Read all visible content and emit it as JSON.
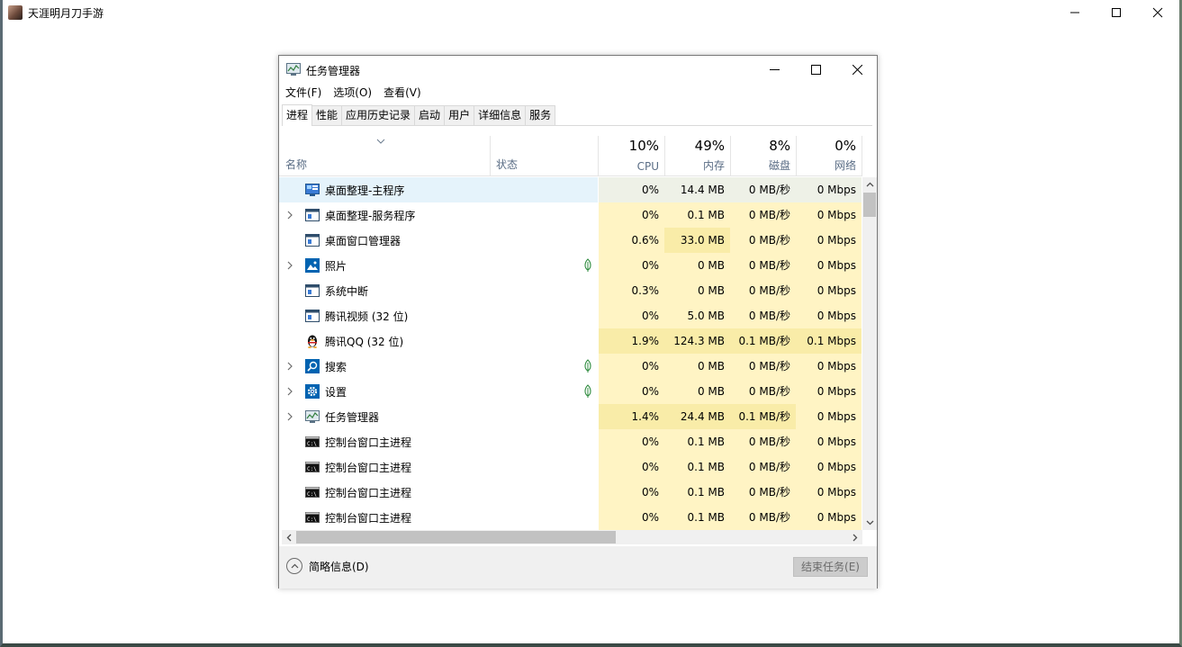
{
  "outer_window": {
    "title": "天涯明月刀手游"
  },
  "task_manager": {
    "title": "任务管理器",
    "menu": [
      "文件(F)",
      "选项(O)",
      "查看(V)"
    ],
    "tabs": [
      "进程",
      "性能",
      "应用历史记录",
      "启动",
      "用户",
      "详细信息",
      "服务"
    ],
    "active_tab": "进程",
    "columns": {
      "name": "名称",
      "status": "状态",
      "cpu": {
        "percent": "10%",
        "label": "CPU"
      },
      "memory": {
        "percent": "49%",
        "label": "内存"
      },
      "disk": {
        "percent": "8%",
        "label": "磁盘"
      },
      "network": {
        "percent": "0%",
        "label": "网络"
      }
    },
    "rows": [
      {
        "name": "桌面整理-主程序",
        "icon": "desktop-app-icon",
        "expandable": false,
        "suspended": false,
        "cpu": "0%",
        "memory": "14.4 MB",
        "disk": "0 MB/秒",
        "network": "0 Mbps",
        "selected": true
      },
      {
        "name": "桌面整理-服务程序",
        "icon": "window-app-icon",
        "expandable": true,
        "suspended": false,
        "cpu": "0%",
        "memory": "0.1 MB",
        "disk": "0 MB/秒",
        "network": "0 Mbps"
      },
      {
        "name": "桌面窗口管理器",
        "icon": "window-app-icon",
        "expandable": false,
        "suspended": false,
        "cpu": "0.6%",
        "memory": "33.0 MB",
        "disk": "0 MB/秒",
        "network": "0 Mbps"
      },
      {
        "name": "照片",
        "icon": "photos-icon",
        "expandable": true,
        "suspended": true,
        "cpu": "0%",
        "memory": "0 MB",
        "disk": "0 MB/秒",
        "network": "0 Mbps"
      },
      {
        "name": "系统中断",
        "icon": "window-app-icon",
        "expandable": false,
        "suspended": false,
        "cpu": "0.3%",
        "memory": "0 MB",
        "disk": "0 MB/秒",
        "network": "0 Mbps"
      },
      {
        "name": "腾讯视频 (32 位)",
        "icon": "window-app-icon",
        "expandable": false,
        "suspended": false,
        "cpu": "0%",
        "memory": "5.0 MB",
        "disk": "0 MB/秒",
        "network": "0 Mbps"
      },
      {
        "name": "腾讯QQ (32 位)",
        "icon": "qq-penguin-icon",
        "expandable": false,
        "suspended": false,
        "cpu": "1.9%",
        "memory": "124.3 MB",
        "disk": "0.1 MB/秒",
        "network": "0.1 Mbps"
      },
      {
        "name": "搜索",
        "icon": "search-icon",
        "expandable": true,
        "suspended": true,
        "cpu": "0%",
        "memory": "0 MB",
        "disk": "0 MB/秒",
        "network": "0 Mbps"
      },
      {
        "name": "设置",
        "icon": "gear-icon",
        "expandable": true,
        "suspended": true,
        "cpu": "0%",
        "memory": "0 MB",
        "disk": "0 MB/秒",
        "network": "0 Mbps"
      },
      {
        "name": "任务管理器",
        "icon": "task-manager-icon",
        "expandable": true,
        "suspended": false,
        "cpu": "1.4%",
        "memory": "24.4 MB",
        "disk": "0.1 MB/秒",
        "network": "0 Mbps"
      },
      {
        "name": "控制台窗口主进程",
        "icon": "console-icon",
        "expandable": false,
        "suspended": false,
        "cpu": "0%",
        "memory": "0.1 MB",
        "disk": "0 MB/秒",
        "network": "0 Mbps"
      },
      {
        "name": "控制台窗口主进程",
        "icon": "console-icon",
        "expandable": false,
        "suspended": false,
        "cpu": "0%",
        "memory": "0.1 MB",
        "disk": "0 MB/秒",
        "network": "0 Mbps"
      },
      {
        "name": "控制台窗口主进程",
        "icon": "console-icon",
        "expandable": false,
        "suspended": false,
        "cpu": "0%",
        "memory": "0.1 MB",
        "disk": "0 MB/秒",
        "network": "0 Mbps"
      },
      {
        "name": "控制台窗口主进程",
        "icon": "console-icon",
        "expandable": false,
        "suspended": false,
        "cpu": "0%",
        "memory": "0.1 MB",
        "disk": "0 MB/秒",
        "network": "0 Mbps"
      }
    ],
    "footer": {
      "fewer_details": "简略信息(D)",
      "end_task": "结束任务(E)"
    }
  }
}
